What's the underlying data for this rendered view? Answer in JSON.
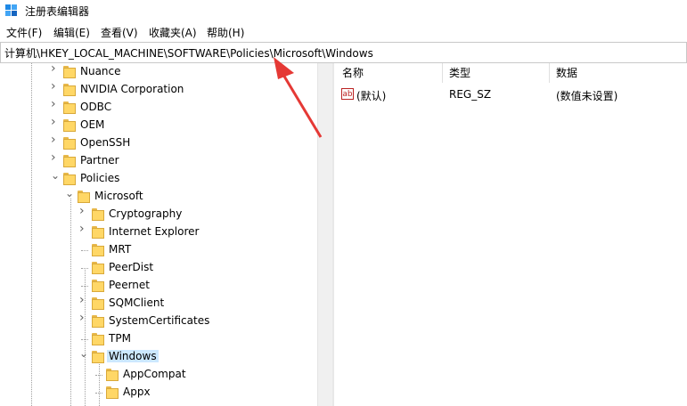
{
  "window": {
    "title": "注册表编辑器"
  },
  "menu": [
    "文件(F)",
    "编辑(E)",
    "查看(V)",
    "收藏夹(A)",
    "帮助(H)"
  ],
  "address": "计算机\\HKEY_LOCAL_MACHINE\\SOFTWARE\\Policies\\Microsoft\\Windows",
  "tree": {
    "level1": [
      {
        "label": "Nuance",
        "expander": "collapsed"
      },
      {
        "label": "NVIDIA Corporation",
        "expander": "collapsed"
      },
      {
        "label": "ODBC",
        "expander": "collapsed"
      },
      {
        "label": "OEM",
        "expander": "collapsed"
      },
      {
        "label": "OpenSSH",
        "expander": "collapsed"
      },
      {
        "label": "Partner",
        "expander": "collapsed"
      },
      {
        "label": "Policies",
        "expander": "expanded"
      }
    ],
    "microsoft": {
      "label": "Microsoft",
      "expander": "expanded"
    },
    "level3": [
      {
        "label": "Cryptography",
        "expander": "collapsed"
      },
      {
        "label": "Internet Explorer",
        "expander": "collapsed"
      },
      {
        "label": "MRT",
        "expander": "none"
      },
      {
        "label": "PeerDist",
        "expander": "none"
      },
      {
        "label": "Peernet",
        "expander": "none"
      },
      {
        "label": "SQMClient",
        "expander": "collapsed"
      },
      {
        "label": "SystemCertificates",
        "expander": "collapsed"
      },
      {
        "label": "TPM",
        "expander": "none"
      },
      {
        "label": "Windows",
        "expander": "expanded",
        "selected": true
      }
    ],
    "level4": [
      {
        "label": "AppCompat"
      },
      {
        "label": "Appx"
      }
    ]
  },
  "list": {
    "columns": {
      "name": "名称",
      "type": "类型",
      "data": "数据"
    },
    "rows": [
      {
        "icon": "string-value-icon",
        "icon_text": "ab",
        "name": "(默认)",
        "type": "REG_SZ",
        "data": "(数值未设置)"
      }
    ]
  },
  "colors": {
    "selection": "#cce8ff",
    "folder": "#ffd766",
    "arrow": "#e53935"
  }
}
